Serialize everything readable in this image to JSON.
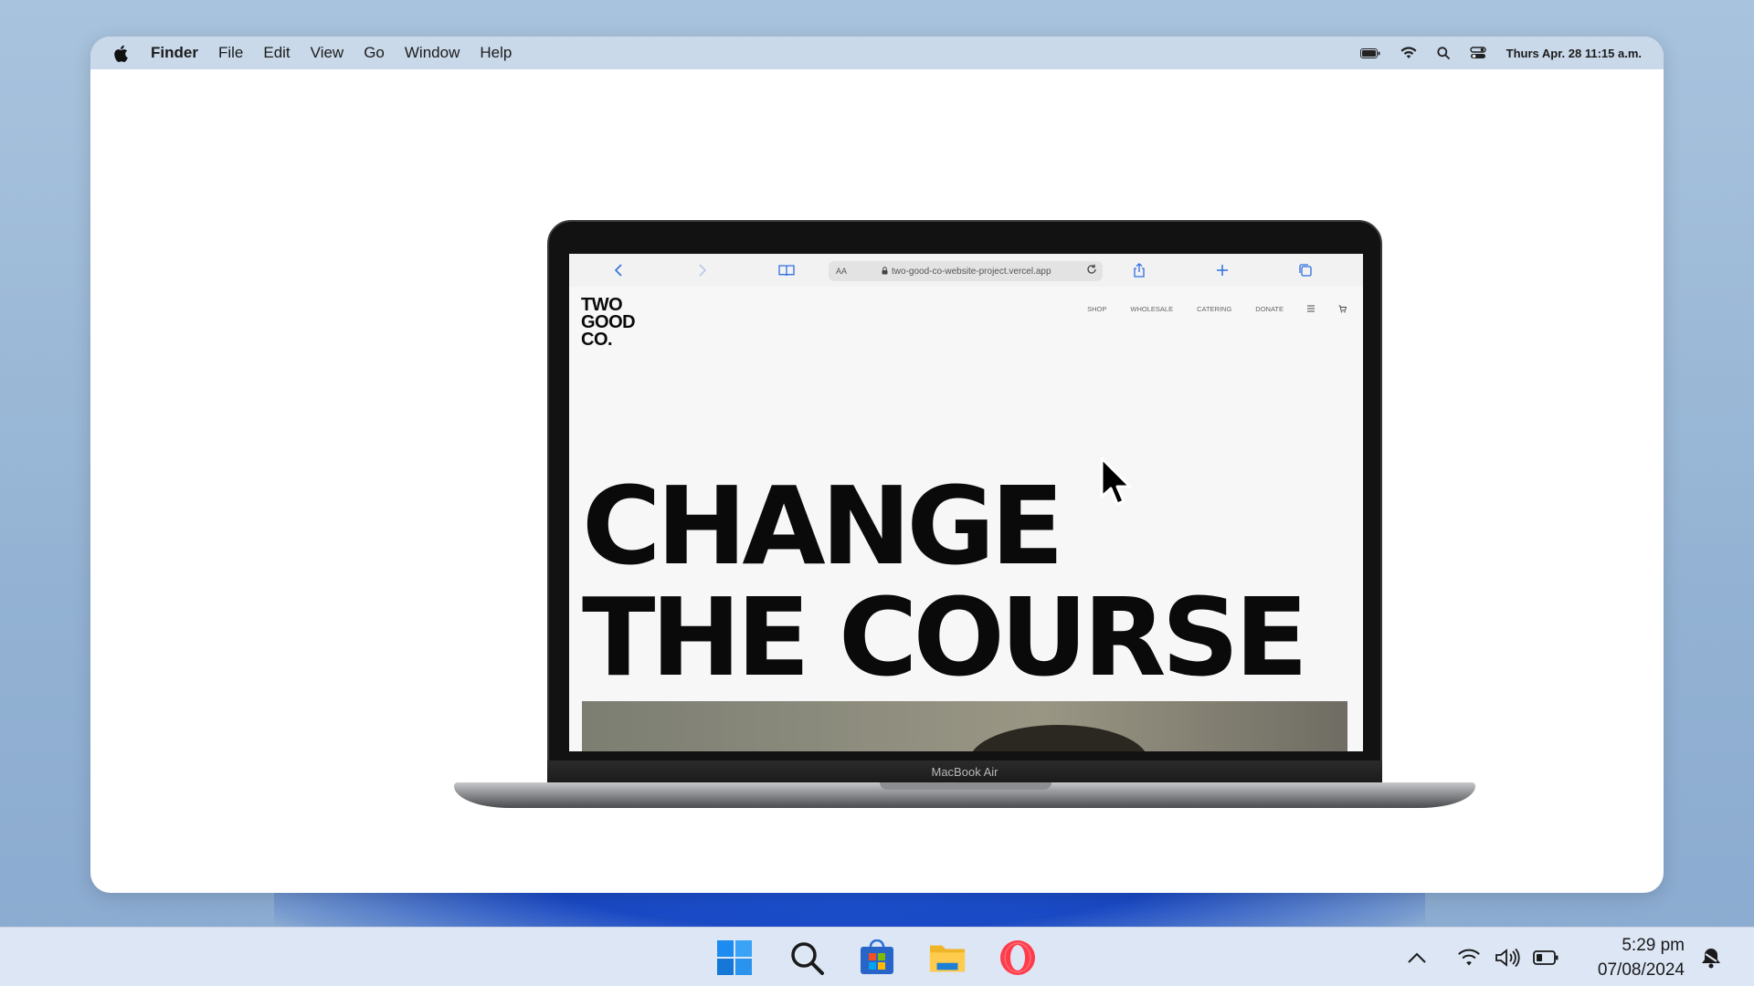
{
  "mac": {
    "menubar": {
      "items": [
        "Finder",
        "File",
        "Edit",
        "View",
        "Go",
        "Window",
        "Help"
      ],
      "datetime": "Thurs Apr. 28 11:15 a.m."
    }
  },
  "laptop": {
    "model_label": "MacBook Air",
    "browser": {
      "url": "two-good-co-website-project.vercel.app",
      "text_size_label": "AA"
    },
    "site": {
      "logo": [
        "TWO",
        "GOOD",
        "CO."
      ],
      "nav": [
        "SHOP",
        "WHOLESALE",
        "CATERING",
        "DONATE"
      ],
      "hero_line1": "CHANGE",
      "hero_line2": "THE COURSE"
    }
  },
  "taskbar": {
    "time": "5:29 pm",
    "date": "07/08/2024",
    "pinned": [
      "start-icon",
      "search-icon",
      "store-icon",
      "file-explorer-icon",
      "opera-icon"
    ],
    "tray": [
      "chevron-up-icon",
      "wifi-icon",
      "volume-icon",
      "battery-icon",
      "notification-bell-icon"
    ]
  },
  "colors": {
    "desktop_bg": "#a0bcd9",
    "taskbar_bg": "#dce6f5",
    "mac_menubar": "#c9d9ea",
    "safari_accent": "#2f6fe0"
  }
}
